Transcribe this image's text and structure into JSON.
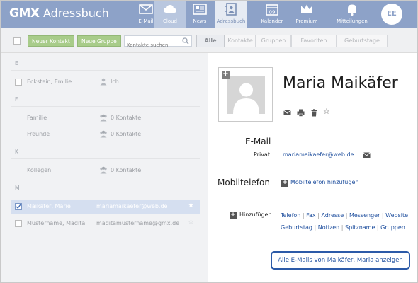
{
  "app": {
    "logo": "GMX",
    "title": "Adressbuch"
  },
  "nav": [
    {
      "label": "E-Mail",
      "icon": "mail-icon"
    },
    {
      "label": "Cloud",
      "icon": "cloud-icon"
    },
    {
      "label": "News",
      "icon": "news-icon"
    },
    {
      "label": "Adressbuch",
      "icon": "addressbook-icon"
    },
    {
      "label": "Kalender",
      "icon": "calendar-icon"
    },
    {
      "label": "Premium",
      "icon": "crown-icon"
    },
    {
      "label": "Mitteilungen",
      "icon": "bell-icon"
    }
  ],
  "calendar_day": "09",
  "user_initials": "EE",
  "toolbar": {
    "new_contact": "Neuer Kontakt",
    "new_group": "Neue Gruppe",
    "search_placeholder": "Kontakte suchen",
    "filters": [
      "Alle",
      "Kontakte",
      "Gruppen",
      "Favoriten",
      "Geburtstage"
    ]
  },
  "groups": [
    {
      "letter": "E",
      "rows": [
        {
          "name": "Eckstein, Emilie",
          "info": "Ich",
          "icon": "person-icon"
        }
      ]
    },
    {
      "letter": "F",
      "rows": [
        {
          "name": "Familie",
          "info": "0 Kontakte",
          "icon": "group-icon"
        },
        {
          "name": "Freunde",
          "info": "0 Kontakte",
          "icon": "group-icon"
        }
      ]
    },
    {
      "letter": "K",
      "rows": [
        {
          "name": "Kollegen",
          "info": "0 Kontakte",
          "icon": "group-icon"
        }
      ]
    },
    {
      "letter": "M",
      "rows": [
        {
          "name": "Maikäfer, Marie",
          "info": "mariamaikaefer@web.de",
          "selected": true
        },
        {
          "name": "Mustername, Madita",
          "info": "maditamustername@gmx.de"
        }
      ]
    }
  ],
  "detail": {
    "name": "Maria Maikäfer",
    "email_heading": "E-Mail",
    "email_type": "Privat",
    "email": "mariamaikaefer@web.de",
    "mobile_heading": "Mobiltelefon",
    "mobile_add": "Mobiltelefon hinzufügen",
    "add_label": "Hinzufügen",
    "add_links_1": [
      "Telefon",
      "Fax",
      "Adresse",
      "Messenger",
      "Website"
    ],
    "add_links_2": [
      "Geburtstag",
      "Notizen",
      "Spitzname",
      "Gruppen"
    ],
    "all_emails_button": "Alle E-Mails von Maikäfer, Maria anzeigen"
  },
  "colors": {
    "nav": "#8da2c8",
    "link": "#1f4f9e",
    "selected_row": "#d5dff0",
    "green_button": "#a8cc8a"
  }
}
